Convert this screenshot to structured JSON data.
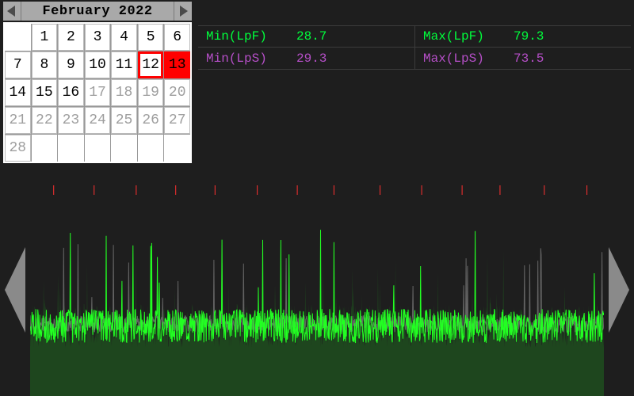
{
  "month_bar": {
    "title": "February 2022"
  },
  "calendar": {
    "leading_blanks": 1,
    "days_in_month": 28,
    "active_through": 16,
    "highlighted_day": 12,
    "selected_day": 13,
    "trailing_blanks": 6
  },
  "metrics": [
    {
      "label": "Min(LpF)",
      "value": "28.7",
      "color": "#00ff3c"
    },
    {
      "label": "Max(LpF)",
      "value": "79.3",
      "color": "#00ff3c"
    },
    {
      "label": "Min(LpS)",
      "value": "29.3",
      "color": "#b64fc8"
    },
    {
      "label": "Max(LpS)",
      "value": "73.5",
      "color": "#b64fc8"
    }
  ],
  "colors": {
    "waveform_fast": "#22ff22",
    "waveform_slow": "#6c6c6c",
    "tick": "#ff3030",
    "bg": "#1e1e1e"
  },
  "chart_data": {
    "type": "line",
    "title": "",
    "xlabel": "",
    "ylabel": "",
    "note": "dense irregular audio-level waveform; values estimated visually",
    "ylim": [
      0,
      100
    ],
    "x_ticks_approx": 14,
    "series": [
      {
        "name": "LpF",
        "color": "#22ff22",
        "baseline": 33,
        "noise_amplitude": 8,
        "spikes_to": 79,
        "min": 28.7,
        "max": 79.3
      },
      {
        "name": "LpS",
        "color": "#6c6c6c",
        "baseline": 34,
        "noise_amplitude": 4,
        "spikes_to": 73,
        "min": 29.3,
        "max": 73.5
      }
    ]
  }
}
